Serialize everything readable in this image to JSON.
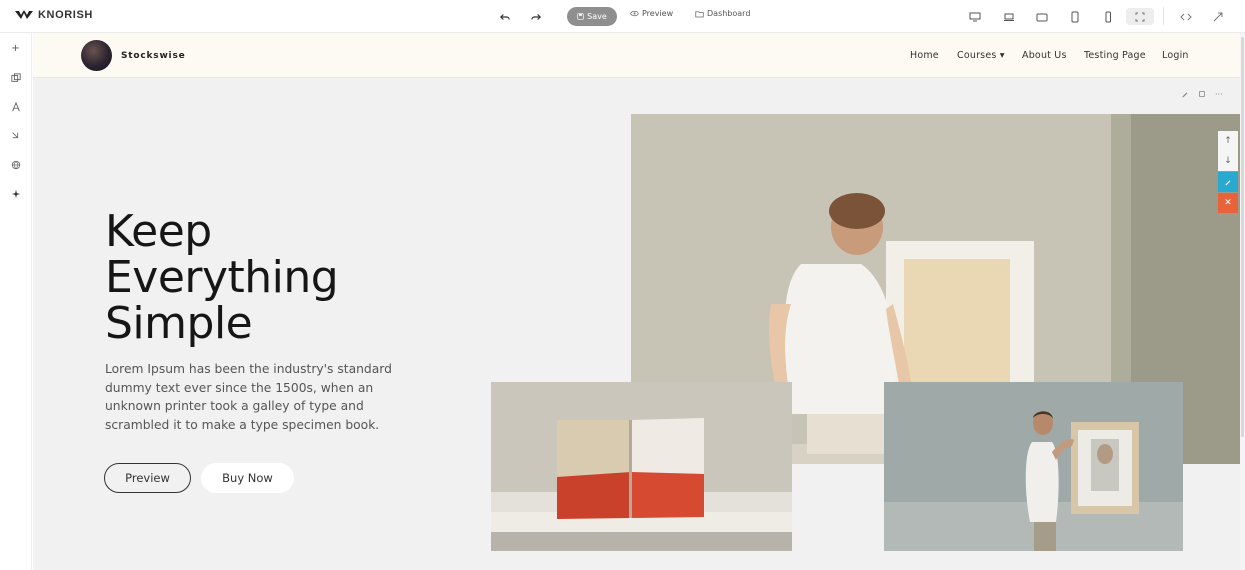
{
  "toolbar": {
    "brand": "KNORISH",
    "save_label": "Save",
    "preview_label": "Preview",
    "dashboard_label": "Dashboard"
  },
  "site": {
    "name": "Stockswise",
    "nav": [
      {
        "label": "Home"
      },
      {
        "label": "Courses ▾"
      },
      {
        "label": "About Us"
      },
      {
        "label": "Testing Page"
      },
      {
        "label": "Login"
      }
    ]
  },
  "hero": {
    "title": "Keep Everything Simple",
    "text": "Lorem Ipsum has been the industry's standard dummy text ever since the 1500s, when an unknown printer took a galley of type and scrambled it to make a type specimen book.",
    "preview_btn": "Preview",
    "buy_btn": "Buy Now"
  },
  "colors": {
    "accent_edit": "#29a9cf",
    "accent_delete": "#e8623a",
    "nav_bg": "#fdfaf3",
    "canvas_bg": "#f1f1f1"
  },
  "icons": [
    "logo-icon",
    "undo-icon",
    "redo-icon",
    "save-icon",
    "eye-icon",
    "folder-icon",
    "desktop-icon",
    "laptop-icon",
    "tablet-landscape-icon",
    "tablet-icon",
    "mobile-icon",
    "fullscreen-icon",
    "code-icon",
    "expand-icon",
    "plus-icon",
    "layers-icon",
    "text-icon",
    "paint-icon",
    "globe-icon",
    "sparkle-icon",
    "pencil-icon",
    "copy-icon",
    "more-icon",
    "arrow-up-icon",
    "arrow-down-icon",
    "close-icon"
  ]
}
